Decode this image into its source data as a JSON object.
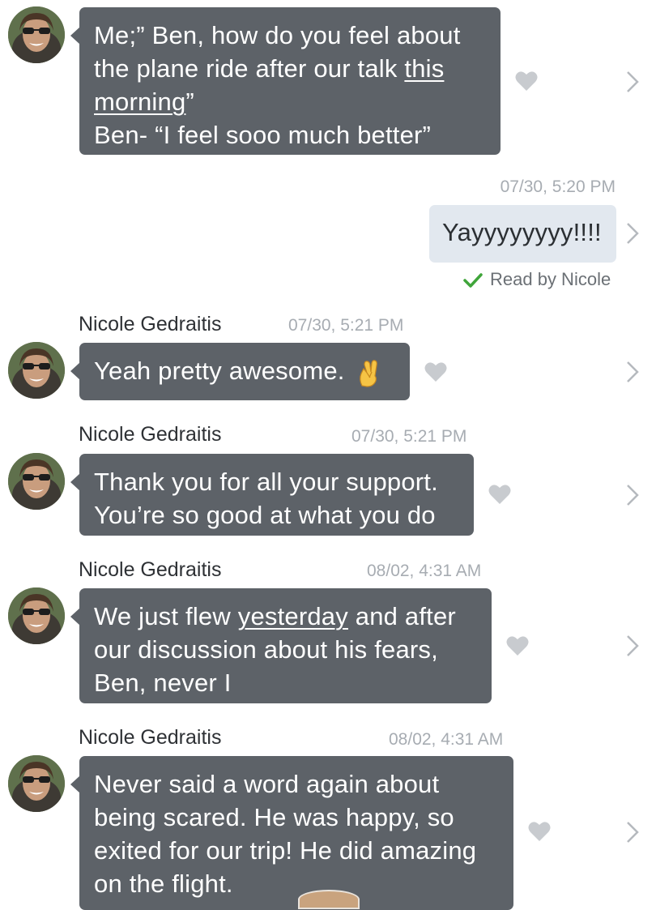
{
  "messages": [
    {
      "id": "m1",
      "direction": "incoming",
      "lines": [
        {
          "parts": [
            {
              "text": "Me;” Ben, how do you feel about",
              "u": false
            }
          ]
        },
        {
          "parts": [
            {
              "text": "the plane ride after our talk ",
              "u": false
            },
            {
              "text": "this",
              "u": true
            }
          ]
        },
        {
          "parts": [
            {
              "text": "morning",
              "u": true
            },
            {
              "text": "”",
              "u": false
            }
          ]
        },
        {
          "parts": [
            {
              "text": "Ben- “I feel sooo much better”",
              "u": false
            }
          ]
        }
      ]
    },
    {
      "id": "m2",
      "direction": "outgoing",
      "timestamp": "07/30, 5:20 PM",
      "lines": [
        {
          "parts": [
            {
              "text": "Yayyyyyyyy!!!!",
              "u": false
            }
          ]
        }
      ],
      "read_receipt": "Read by Nicole"
    },
    {
      "id": "m3",
      "direction": "incoming",
      "sender": "Nicole Gedraitis",
      "timestamp": "07/30, 5:21 PM",
      "lines": [
        {
          "parts": [
            {
              "text": "Yeah pretty awesome. ",
              "u": false
            }
          ]
        }
      ],
      "emoji": "crossed-fingers"
    },
    {
      "id": "m4",
      "direction": "incoming",
      "sender": "Nicole Gedraitis",
      "timestamp": "07/30, 5:21 PM",
      "lines": [
        {
          "parts": [
            {
              "text": "Thank you for all your support.",
              "u": false
            }
          ]
        },
        {
          "parts": [
            {
              "text": "You’re so good at what you do",
              "u": false
            }
          ]
        }
      ]
    },
    {
      "id": "m5",
      "direction": "incoming",
      "sender": "Nicole Gedraitis",
      "timestamp": "08/02, 4:31 AM",
      "lines": [
        {
          "parts": [
            {
              "text": "We just flew ",
              "u": false
            },
            {
              "text": "yesterday",
              "u": true
            },
            {
              "text": " and after",
              "u": false
            }
          ]
        },
        {
          "parts": [
            {
              "text": "our discussion about his fears,",
              "u": false
            }
          ]
        },
        {
          "parts": [
            {
              "text": "Ben, never I",
              "u": false
            }
          ]
        }
      ]
    },
    {
      "id": "m6",
      "direction": "incoming",
      "sender": "Nicole Gedraitis",
      "timestamp": "08/02, 4:31 AM",
      "lines": [
        {
          "parts": [
            {
              "text": "Never said a word again about",
              "u": false
            }
          ]
        },
        {
          "parts": [
            {
              "text": "being scared. He was happy, so",
              "u": false
            }
          ]
        },
        {
          "parts": [
            {
              "text": "exited for our trip! He did amazing",
              "u": false
            }
          ]
        },
        {
          "parts": [
            {
              "text": "on the flight.",
              "u": false
            }
          ]
        }
      ]
    }
  ],
  "icons": {
    "heart": "heart-icon",
    "chevron": "chevron-right-icon",
    "check": "checkmark-icon",
    "avatar": "avatar"
  },
  "colors": {
    "bubble_incoming": "#5d6268",
    "bubble_outgoing": "#e2e8ef",
    "check_green": "#3fa53a",
    "heart_gray": "#c8cbcf",
    "chevron_gray": "#b5b9be",
    "timestamp_gray": "#a7acb2"
  }
}
